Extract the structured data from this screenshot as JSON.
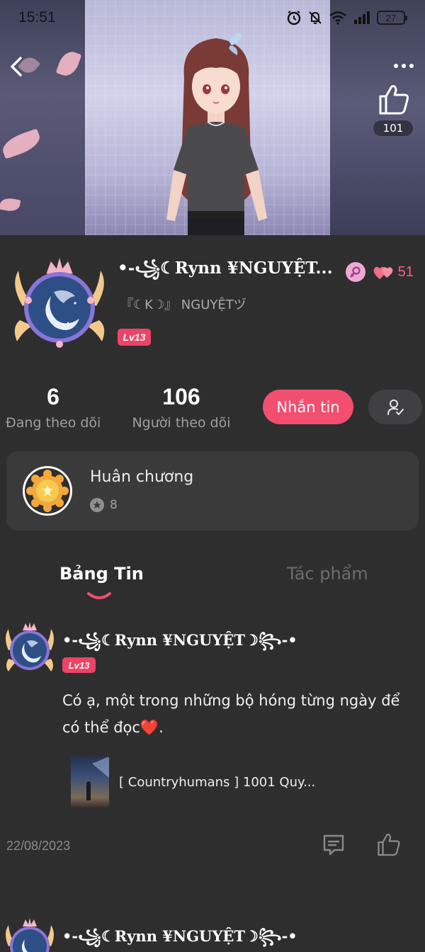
{
  "status_bar": {
    "time": "15:51",
    "battery": "27",
    "icons": [
      "alarm-icon",
      "mute-icon",
      "wifi-icon",
      "signal-icon",
      "battery-icon"
    ]
  },
  "header": {
    "back_icon": "back-chevron-icon",
    "more_icon": "more-dots-icon",
    "like_icon": "thumbs-up-icon",
    "like_count": "101"
  },
  "profile": {
    "username": "•-꧁☾𝐑𝐲𝐧𝐧 ¥NGUYỆT...",
    "alias": "『☾K☽』 NGUYỆTヅ",
    "level": "Lv13",
    "gender_icon": "female-icon",
    "fans_icon": "hearts-icon",
    "fans_count": "51",
    "following_count": "6",
    "following_label": "Đang theo dõi",
    "followers_count": "106",
    "followers_label": "Người theo dõi",
    "message_button": "Nhắn tin",
    "follow_icon": "user-check-icon"
  },
  "medals": {
    "title": "Huân chương",
    "count": "8",
    "star_icon": "star-circle-icon"
  },
  "tabs": [
    {
      "label": "Bảng Tin",
      "active": true
    },
    {
      "label": "Tác phẩm",
      "active": false
    }
  ],
  "posts": [
    {
      "author": "•-꧁☾𝐑𝐲𝐧𝐧 ¥NGUYỆT☽꧂-•",
      "level": "Lv13",
      "text": "Có ạ, một trong những bộ hóng từng ngày để có thể đọc❤️.",
      "link_title": "[ Countryhumans ] 1001 Quy...",
      "date": "22/08/2023",
      "comment_icon": "comment-icon",
      "like_icon": "thumbs-up-icon"
    },
    {
      "author": "•-꧁☾𝐑𝐲𝐧𝐧 ¥NGUYỆT☽꧂-•"
    }
  ],
  "colors": {
    "background": "#2e2e2f",
    "accent": "#f24f70",
    "level_badge": "#ec4467",
    "card": "#3a3a3b"
  }
}
